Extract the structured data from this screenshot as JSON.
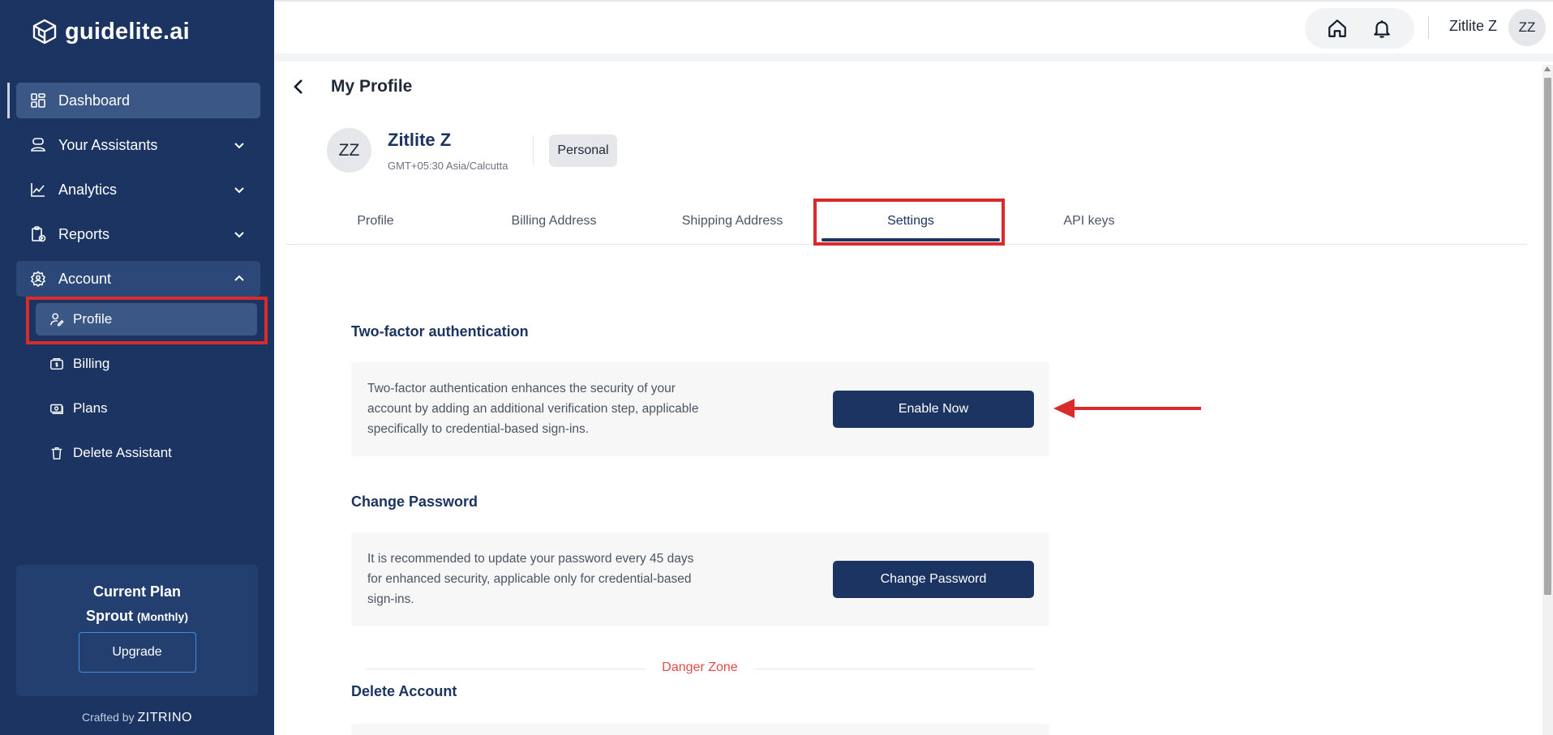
{
  "brand": {
    "name": "guidelite.ai"
  },
  "sidebar": {
    "items": [
      {
        "label": "Dashboard",
        "icon": "dashboard-icon"
      },
      {
        "label": "Your Assistants",
        "icon": "assistant-icon"
      },
      {
        "label": "Analytics",
        "icon": "analytics-icon"
      },
      {
        "label": "Reports",
        "icon": "reports-icon"
      },
      {
        "label": "Account",
        "icon": "account-gear-icon"
      }
    ],
    "sub_items": [
      {
        "label": "Profile",
        "icon": "user-edit-icon"
      },
      {
        "label": "Billing",
        "icon": "billing-icon"
      },
      {
        "label": "Plans",
        "icon": "plans-icon"
      },
      {
        "label": "Delete Assistant",
        "icon": "trash-icon"
      }
    ],
    "plan": {
      "title": "Current Plan",
      "name": "Sprout",
      "cycle": "(Monthly)",
      "upgrade_label": "Upgrade"
    },
    "crafted_by": "Crafted by",
    "crafted_brand": "ZITRINO"
  },
  "topbar": {
    "user_name": "Zitlite Z",
    "avatar_initials": "ZZ"
  },
  "page": {
    "title": "My Profile",
    "profile": {
      "initials": "ZZ",
      "name": "Zitlite Z",
      "timezone": "GMT+05:30 Asia/Calcutta",
      "badge": "Personal"
    },
    "tabs": [
      "Profile",
      "Billing Address",
      "Shipping Address",
      "Settings",
      "API keys"
    ],
    "active_tab": "Settings",
    "two_factor": {
      "title": "Two-factor authentication",
      "description": "Two-factor authentication enhances the security of your account by adding an additional verification step, applicable specifically to credential-based sign-ins.",
      "button": "Enable Now"
    },
    "change_password": {
      "title": "Change Password",
      "description": "It is recommended to update your password every 45 days for enhanced security, applicable only for credential-based sign-ins.",
      "button": "Change Password"
    },
    "danger_zone": {
      "label": "Danger Zone"
    },
    "delete_account": {
      "title": "Delete Account"
    }
  },
  "colors": {
    "sidebar_bg": "#1b3461",
    "accent": "#1b3461",
    "highlight_red": "#d92b2b",
    "danger": "#e14b4b"
  }
}
